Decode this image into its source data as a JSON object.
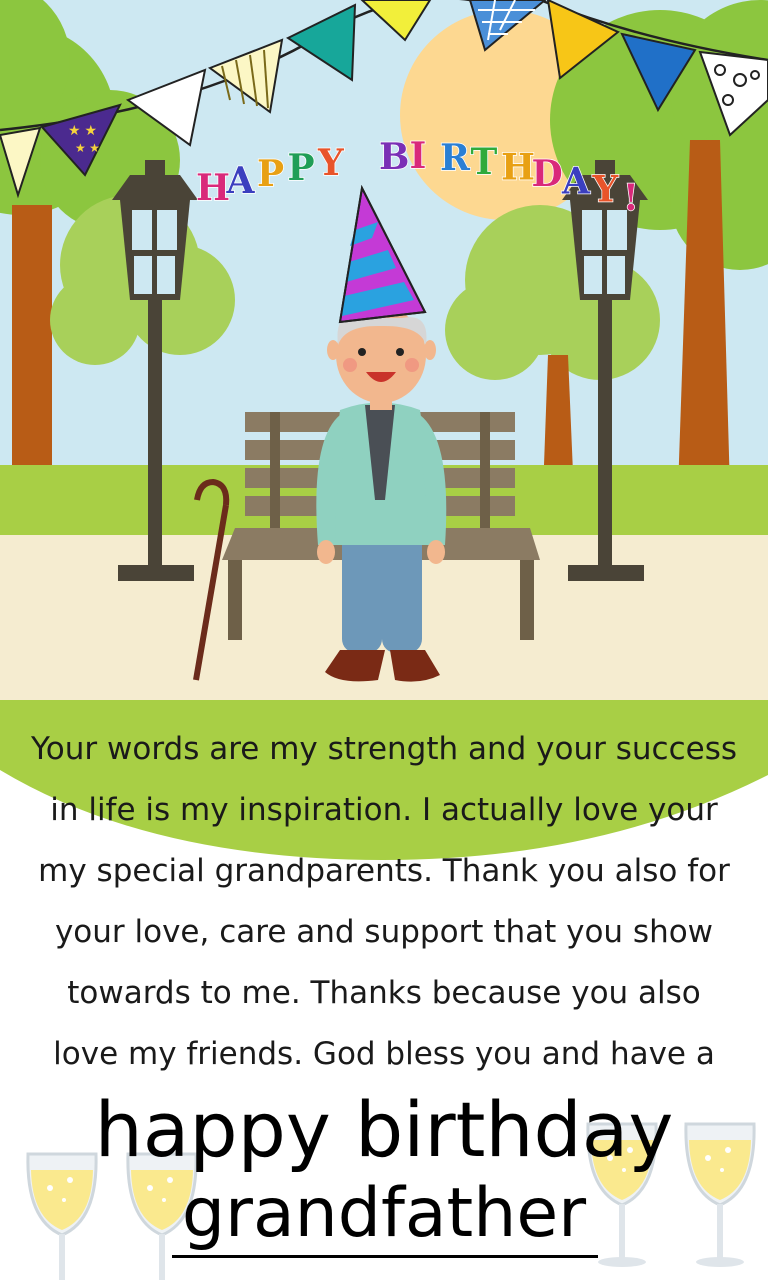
{
  "banner": {
    "text": "HAPPY BIRTHDAY!",
    "letters": [
      "H",
      "A",
      "P",
      "P",
      "Y",
      " ",
      "B",
      "I",
      "R",
      "T",
      "H",
      "D",
      "A",
      "Y",
      "!"
    ],
    "letter_colors": [
      "#d9297a",
      "#3b3fbf",
      "#e8a013",
      "#1f9e57",
      "#e8542a",
      "",
      "#7a2fb5",
      "#d9297a",
      "#2a7fd4",
      "#2faa3b",
      "#e8a013",
      "#d9297a",
      "#3b3fbf",
      "#e8542a",
      "#d9297a"
    ]
  },
  "message": {
    "lines": [
      "Your words are my strength and your success",
      "in life is my inspiration. I actually love your",
      "my special grandparents. Thank you also for",
      "your love, care and support that you show",
      "towards to me. Thanks because you also",
      "love my friends. God bless you and have a"
    ]
  },
  "headline": {
    "line1": "happy birthday",
    "line2": "grandfather"
  },
  "colors": {
    "sky": "#cde8f2",
    "sun": "#fdd891",
    "grass": "#a8cf45",
    "path": "#f5ecd0",
    "tree_dark": "#8cc63f",
    "tree_light": "#a8d05a",
    "trunk": "#b85c16",
    "bench": "#8b7b63",
    "lamp": "#4a4437",
    "jacket": "#8fd1c0",
    "pants": "#6d98b9",
    "wine": "#fae98e"
  },
  "icons": [
    "party-hat-icon",
    "bunting-flags-icon",
    "street-lamp-icon",
    "walking-cane-icon",
    "champagne-glass-icon"
  ]
}
